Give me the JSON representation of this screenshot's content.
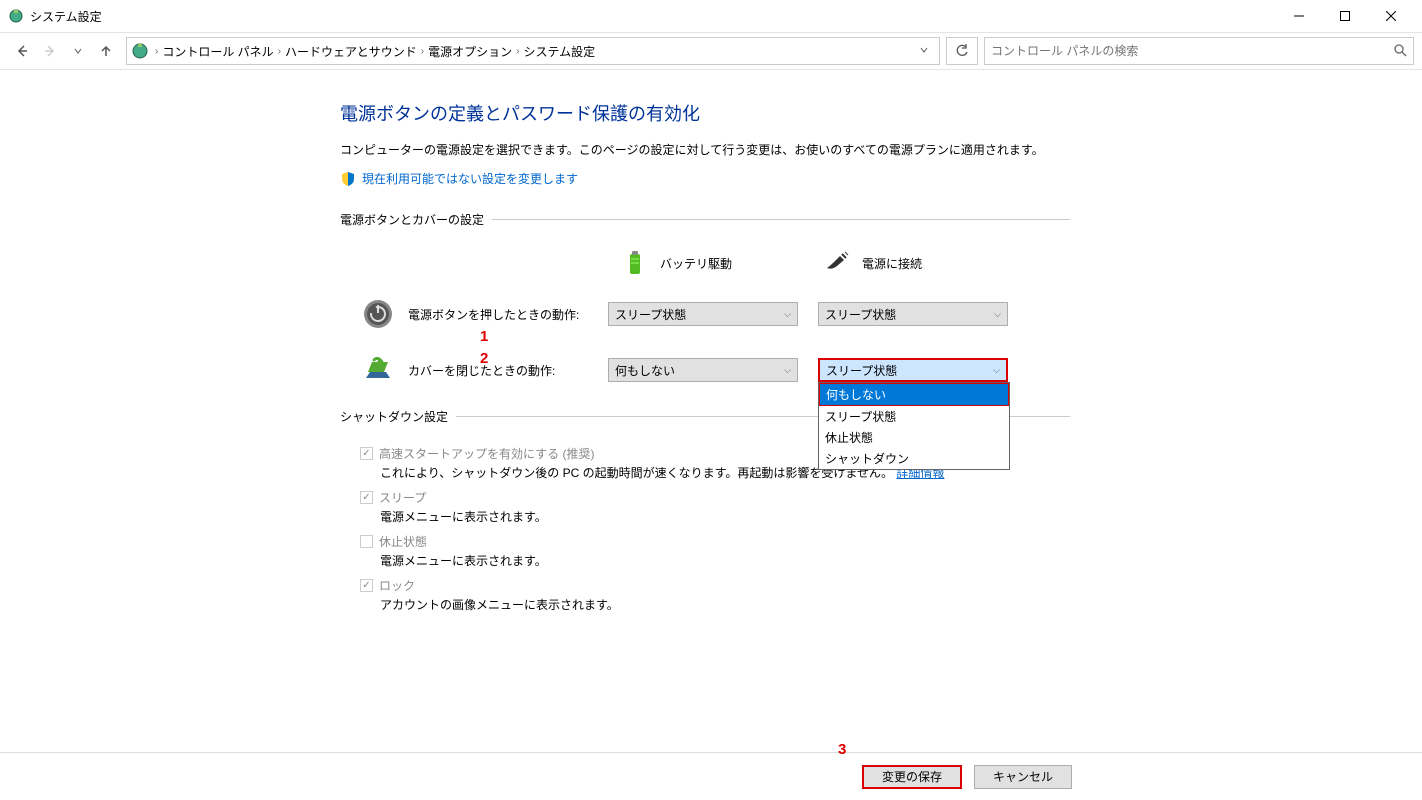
{
  "window": {
    "title": "システム設定"
  },
  "breadcrumbs": [
    "コントロール パネル",
    "ハードウェアとサウンド",
    "電源オプション",
    "システム設定"
  ],
  "search": {
    "placeholder": "コントロール パネルの検索"
  },
  "page": {
    "heading": "電源ボタンの定義とパスワード保護の有効化",
    "description": "コンピューターの電源設定を選択できます。このページの設定に対して行う変更は、お使いのすべての電源プランに適用されます。",
    "admin_link": "現在利用可能ではない設定を変更します"
  },
  "sections": {
    "buttons_title": "電源ボタンとカバーの設定",
    "shutdown_title": "シャットダウン設定"
  },
  "columns": {
    "battery": "バッテリ駆動",
    "plugged": "電源に接続"
  },
  "rows": {
    "power_button": {
      "label": "電源ボタンを押したときの動作:",
      "battery": "スリープ状態",
      "plugged": "スリープ状態"
    },
    "lid_close": {
      "label": "カバーを閉じたときの動作:",
      "battery": "何もしない",
      "plugged": "スリープ状態"
    }
  },
  "dropdown": {
    "selected": "スリープ状態",
    "highlighted": "何もしない",
    "options": [
      "何もしない",
      "スリープ状態",
      "休止状態",
      "シャットダウン"
    ]
  },
  "checkboxes": {
    "fast_startup": {
      "label": "高速スタートアップを有効にする (推奨)",
      "desc_pre": "これにより、シャットダウン後の PC の起動時間が速くなります。再起動は影響を受けません。",
      "link": "詳細情報",
      "checked": true
    },
    "sleep": {
      "label": "スリープ",
      "desc": "電源メニューに表示されます。",
      "checked": true
    },
    "hibernate": {
      "label": "休止状態",
      "desc": "電源メニューに表示されます。",
      "checked": false
    },
    "lock": {
      "label": "ロック",
      "desc": "アカウントの画像メニューに表示されます。",
      "checked": true
    }
  },
  "buttons": {
    "save": "変更の保存",
    "cancel": "キャンセル"
  },
  "annotations": {
    "a1": "1",
    "a2": "2",
    "a3": "3"
  }
}
